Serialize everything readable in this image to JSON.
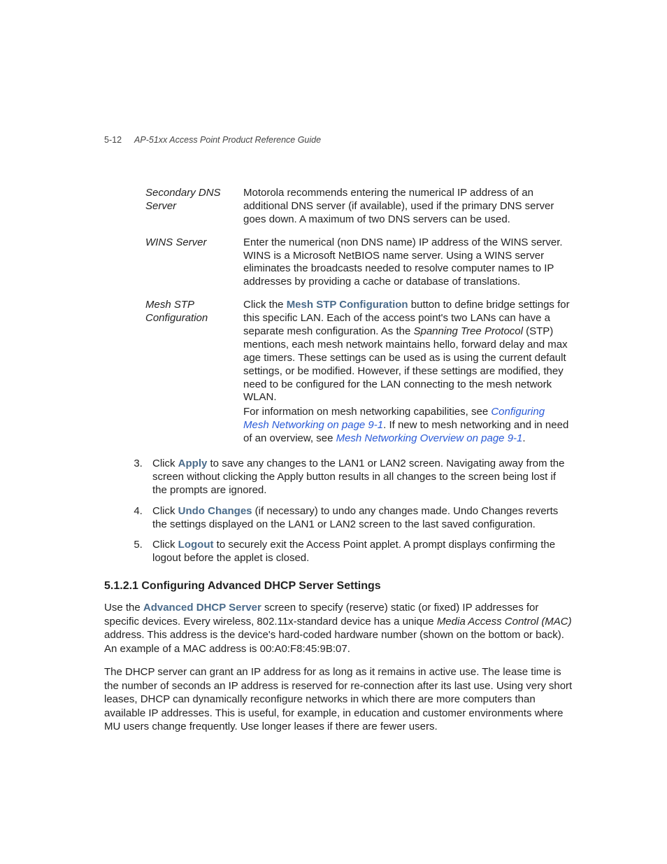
{
  "header": {
    "pagenum": "5-12",
    "title": "AP-51xx Access Point Product Reference Guide"
  },
  "defs": {
    "secondary_dns": {
      "term": "Secondary DNS Server",
      "desc": "Motorola recommends entering the numerical IP address of an additional DNS server (if available), used if the primary DNS server goes down. A maximum of two DNS servers can be used."
    },
    "wins": {
      "term": "WINS Server",
      "desc": "Enter the numerical (non DNS name) IP address of the WINS server. WINS is a Microsoft NetBIOS name server. Using a WINS server eliminates the broadcasts needed to resolve computer names to IP addresses by providing a cache or database of translations."
    },
    "mesh": {
      "term": "Mesh STP Configuration",
      "p1_a": "Click the ",
      "p1_bold": "Mesh STP Configuration",
      "p1_b": " button to define bridge settings for this specific LAN. Each of the access point's two LANs can have a separate mesh configuration. As the ",
      "p1_ital": "Spanning Tree Protocol",
      "p1_c": " (STP) mentions, each mesh network maintains hello, forward delay and max age timers. These settings can be used as is using the current default settings, or be modified. However, if these settings are modified, they need to be configured for the LAN connecting to the mesh network WLAN.",
      "p2_a": "For information on mesh networking capabilities, see ",
      "p2_link1": "Configuring Mesh Networking on page 9-1",
      "p2_b": ". If new to mesh networking and in need of an overview, see ",
      "p2_link2": "Mesh Networking Overview on page 9-1",
      "p2_c": "."
    }
  },
  "steps": {
    "s3_a": "Click ",
    "s3_bold": "Apply",
    "s3_b": " to save any changes to the LAN1 or LAN2 screen. Navigating away from the screen without clicking the Apply button results in all changes to the screen being lost if the prompts are ignored.",
    "s4_a": "Click ",
    "s4_bold": "Undo Changes",
    "s4_b": " (if necessary) to undo any changes made. Undo Changes reverts the settings displayed on the LAN1 or LAN2 screen to the last saved configuration.",
    "s5_a": "Click ",
    "s5_bold": "Logout",
    "s5_b": " to securely exit the Access Point applet. A prompt displays confirming the logout before the applet is closed."
  },
  "section": {
    "heading": "5.1.2.1 Configuring Advanced DHCP Server Settings",
    "p1_a": "Use the ",
    "p1_bold": "Advanced DHCP Server",
    "p1_b": " screen to specify (reserve) static (or fixed) IP addresses for specific devices. Every wireless, 802.11x-standard device has a unique ",
    "p1_ital": "Media Access Control (MAC)",
    "p1_c": " address. This address is the device's hard-coded hardware number (shown on the bottom or back). An example of a MAC address is 00:A0:F8:45:9B:07.",
    "p2": "The DHCP server can grant an IP address for as long as it remains in active use. The lease time is the number of seconds an IP address is reserved for re-connection after its last use. Using very short leases, DHCP can dynamically reconfigure networks in which there are more computers than available IP addresses. This is useful, for example, in education and customer environments where MU users change frequently. Use longer leases if there are fewer users."
  }
}
